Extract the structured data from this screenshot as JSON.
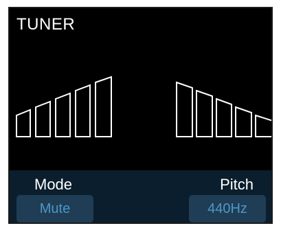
{
  "screen": {
    "title": "TUNER"
  },
  "meter": {
    "left_bars": 5,
    "right_bars": 5,
    "active_segments": 0,
    "outline_color": "#ffffff",
    "background_color": "#000000"
  },
  "controls": {
    "mode_label": "Mode",
    "mode_value": "Mute",
    "pitch_label": "Pitch",
    "pitch_value": "440Hz",
    "panel_color": "#0b1e2d",
    "button_color": "#1f3d55",
    "button_text_color": "#4f97c8"
  }
}
